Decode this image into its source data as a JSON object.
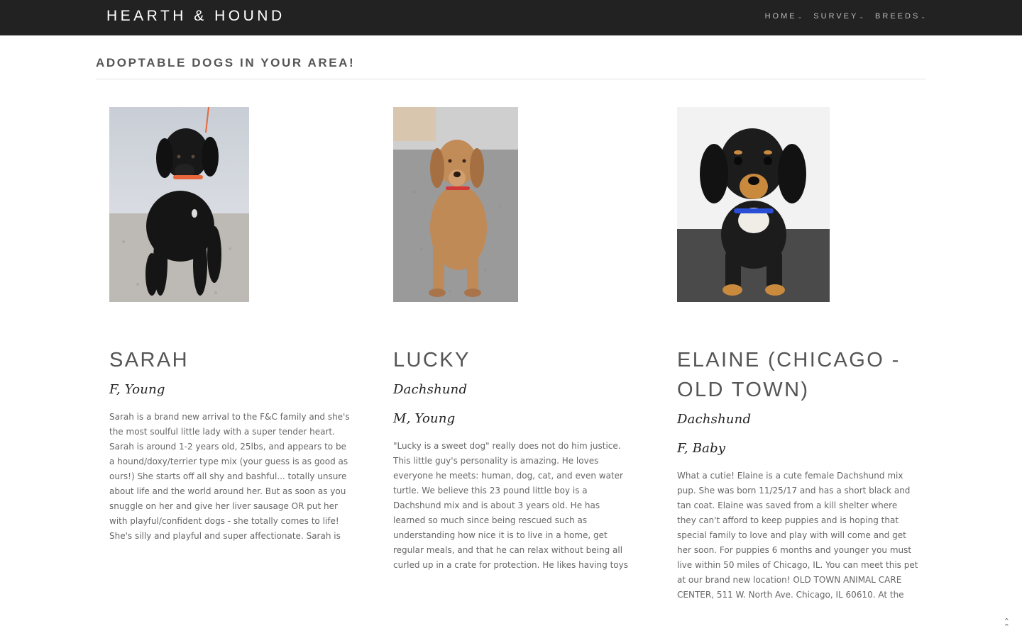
{
  "nav": {
    "brand": "HEARTH & HOUND",
    "items": [
      {
        "label": "HOME"
      },
      {
        "label": "SURVEY"
      },
      {
        "label": "BREEDS"
      }
    ]
  },
  "page": {
    "title": "ADOPTABLE DOGS IN YOUR AREA!"
  },
  "dogs": [
    {
      "name": "SARAH",
      "meta": [
        "F, Young"
      ],
      "description": "Sarah is a brand new arrival to the F&C family and she's the most soulful little lady with a super tender heart. Sarah is around 1-2 years old, 25lbs, and appears to be a hound/doxy/terrier type mix (your guess is as good as ours!) She starts off all shy and bashful... totally unsure about life and the world around her. But as soon as you snuggle on her and give her liver sausage OR put her with playful/confident dogs - she totally comes to life! She's silly and playful and super affectionate. Sarah is very chill and quiet in her crate, great with other animals, gentle with"
    },
    {
      "name": "LUCKY",
      "meta": [
        "Dachshund",
        "M, Young"
      ],
      "description": "\"Lucky is a sweet dog\" really does not do him justice. This little guy's personality is amazing. He loves everyone he meets: human, dog, cat, and even water turtle. We believe this 23 pound little boy is a Dachshund mix and is about 3 years old. He has learned so much since being rescued such as understanding how nice it is to live in a home, get regular meals, and that he can relax without being all curled up in a crate for protection. He likes having toys and is almost ready to share them. He is a bundle of energy but also is learning to enjoy calm time. Due to lack of food in"
    },
    {
      "name": "ELAINE (CHICAGO - OLD TOWN)",
      "meta": [
        "Dachshund",
        "F, Baby"
      ],
      "description": "What a cutie! Elaine is a cute female Dachshund mix pup. She was born 11/25/17 and has a short black and tan coat. Elaine was saved from a kill shelter where they can't afford to keep puppies and is hoping that special family to love and play with will come and get her soon. For puppies 6 months and younger you must live within 50 miles of Chicago, IL. You can meet this pet at our brand new location! OLD TOWN ANIMAL CARE CENTER, 511 W. North Ave. Chicago, IL 60610. At the Old Town Animal Care Center, cats and dogs can be viewed Monday thru Friday"
    }
  ],
  "colors": {
    "navbar_bg": "#222222",
    "brand_text": "#ffffff",
    "heading_text": "#555555",
    "meta_text": "#222222",
    "body_text": "#666666"
  },
  "icons": {
    "nav_dropdown": "chevron-down-icon",
    "back_to_top": "double-chevron-up-icon"
  }
}
